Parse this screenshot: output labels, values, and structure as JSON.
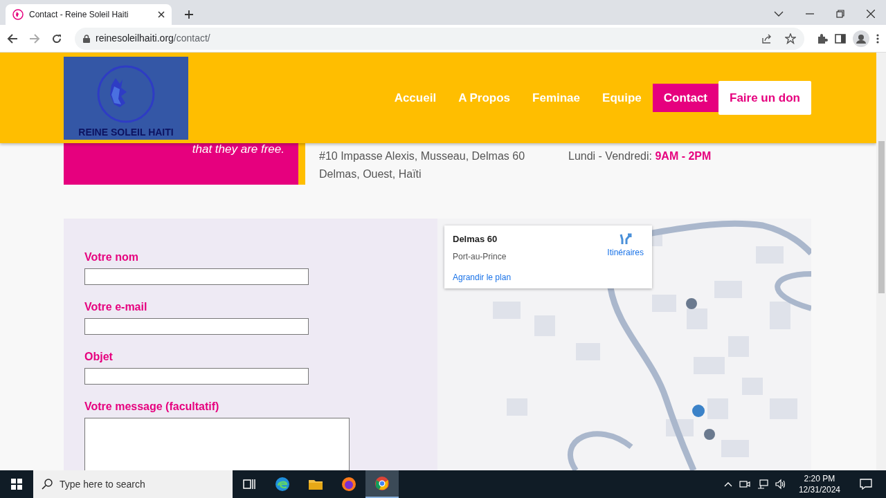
{
  "browser": {
    "tab_title": "Contact - Reine Soleil Haiti",
    "url_domain": "reinesoleilhaiti.org",
    "url_path": "/contact/"
  },
  "site": {
    "logo_text": "REINE SOLEIL HAITI",
    "nav": [
      {
        "label": "Accueil",
        "kind": "link",
        "selected": false
      },
      {
        "label": "A Propos",
        "kind": "link",
        "selected": false
      },
      {
        "label": "Feminae",
        "kind": "link",
        "selected": false
      },
      {
        "label": "Equipe",
        "kind": "link",
        "selected": false
      },
      {
        "label": "Contact",
        "kind": "link",
        "selected": true
      },
      {
        "label": "Faire un don",
        "kind": "donate",
        "selected": false
      }
    ],
    "quote_tail": "that they are free.",
    "address_lines": [
      "#10 Impasse Alexis, Musseau, Delmas 60",
      "Delmas, Ouest, Haïti"
    ],
    "hours_label": "Lundi - Vendredi:",
    "hours_value": "9AM - 2PM"
  },
  "form": {
    "fields": [
      {
        "label": "Votre nom",
        "kind": "input"
      },
      {
        "label": "Votre e-mail",
        "kind": "input"
      },
      {
        "label": "Objet",
        "kind": "input"
      },
      {
        "label": "Votre message (facultatif)",
        "kind": "textarea"
      }
    ]
  },
  "map": {
    "kind": "picture",
    "card": {
      "title": "Delmas 60",
      "subtitle": "Port-au-Prince",
      "directions": "Itinéraires",
      "enlarge": "Agrandir le plan"
    }
  },
  "taskbar": {
    "search_placeholder": "Type here to search",
    "time": "2:20 PM",
    "date": "12/31/2024"
  }
}
